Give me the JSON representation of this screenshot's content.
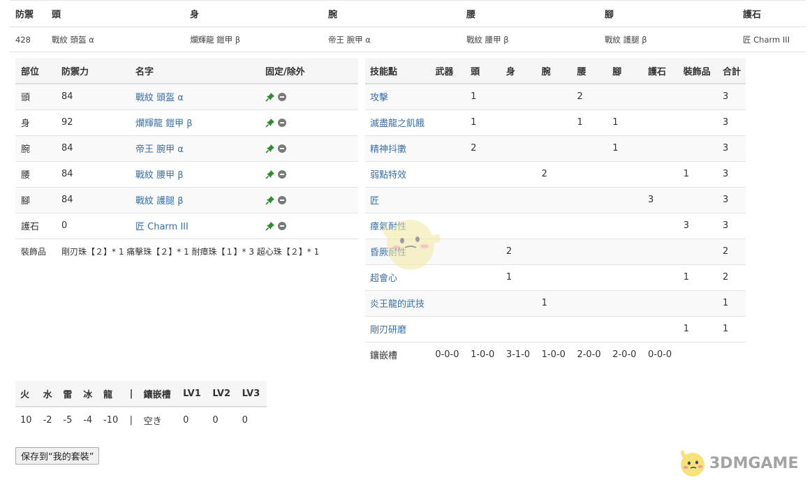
{
  "summary": {
    "headers": [
      "防禦",
      "頭",
      "身",
      "腕",
      "腰",
      "腳",
      "護石"
    ],
    "values": [
      "428",
      "戰紋 頭盔 α",
      "爛輝龍 鎧甲 β",
      "帝王 腕甲 α",
      "戰紋 腰甲 β",
      "戰紋 護腿 β",
      "匠 Charm III"
    ]
  },
  "equipment": {
    "headers": [
      "部位",
      "防禦力",
      "名字",
      "固定/除外"
    ],
    "rows": [
      {
        "slot": "頭",
        "defense": "84",
        "name": "戰紋 頭盔 α"
      },
      {
        "slot": "身",
        "defense": "92",
        "name": "爛輝龍 鎧甲 β"
      },
      {
        "slot": "腕",
        "defense": "84",
        "name": "帝王 腕甲 α"
      },
      {
        "slot": "腰",
        "defense": "84",
        "name": "戰紋 腰甲 β"
      },
      {
        "slot": "腳",
        "defense": "84",
        "name": "戰紋 護腿 β"
      },
      {
        "slot": "護石",
        "defense": "0",
        "name": "匠 Charm III"
      }
    ],
    "decorations_label": "裝飾品",
    "decorations_value": "剛刃珠【２】* 1 痛擊珠【２】* 1 耐瘴珠【１】* 3 超心珠【２】* 1",
    "pin_icon": "pin-icon",
    "exclude_icon": "minus-circle-icon"
  },
  "skills": {
    "headers": [
      "技能點",
      "武器",
      "頭",
      "身",
      "腕",
      "腰",
      "腳",
      "護石",
      "裝飾品",
      "合計"
    ],
    "rows": [
      {
        "name": "攻擊",
        "cells": [
          "",
          "1",
          "",
          "",
          "2",
          "",
          "",
          "",
          "3"
        ]
      },
      {
        "name": "滅盡龍之飢餓",
        "cells": [
          "",
          "1",
          "",
          "",
          "1",
          "1",
          "",
          "",
          "3"
        ]
      },
      {
        "name": "精神抖擻",
        "cells": [
          "",
          "2",
          "",
          "",
          "",
          "1",
          "",
          "",
          "3"
        ]
      },
      {
        "name": "弱點特效",
        "cells": [
          "",
          "",
          "",
          "2",
          "",
          "",
          "",
          "1",
          "3"
        ]
      },
      {
        "name": "匠",
        "cells": [
          "",
          "",
          "",
          "",
          "",
          "",
          "3",
          "",
          "3"
        ]
      },
      {
        "name": "瘴氣耐性",
        "cells": [
          "",
          "",
          "",
          "",
          "",
          "",
          "",
          "3",
          "3"
        ]
      },
      {
        "name": "昏厥耐性",
        "cells": [
          "",
          "",
          "2",
          "",
          "",
          "",
          "",
          "",
          "2"
        ]
      },
      {
        "name": "超會心",
        "cells": [
          "",
          "",
          "1",
          "",
          "",
          "",
          "",
          "1",
          "2"
        ]
      },
      {
        "name": "炎王龍的武技",
        "cells": [
          "",
          "",
          "",
          "1",
          "",
          "",
          "",
          "",
          "1"
        ]
      },
      {
        "name": "剛刃研磨",
        "cells": [
          "",
          "",
          "",
          "",
          "",
          "",
          "",
          "1",
          "1"
        ]
      }
    ],
    "slots_label": "鑲嵌槽",
    "slots": [
      "0-0-0",
      "1-0-0",
      "3-1-0",
      "1-0-0",
      "2-0-0",
      "2-0-0",
      "0-0-0"
    ]
  },
  "resistances": {
    "headers": [
      "火",
      "水",
      "雷",
      "冰",
      "龍",
      "|",
      "鑲嵌槽",
      "LV1",
      "LV2",
      "LV3"
    ],
    "values": [
      "10",
      "-2",
      "-5",
      "-4",
      "-10",
      "|",
      "空き",
      "0",
      "0",
      "0"
    ]
  },
  "save_button_label": "保存到“我的套裝”",
  "logo": {
    "text": "3DMGAME",
    "color": "#a3a3a3"
  },
  "colors": {
    "link": "#3a6fa8",
    "pin": "#2e8b2e",
    "header_bg": "#f5f5f5",
    "stripe_bg": "#f9f9f9"
  }
}
